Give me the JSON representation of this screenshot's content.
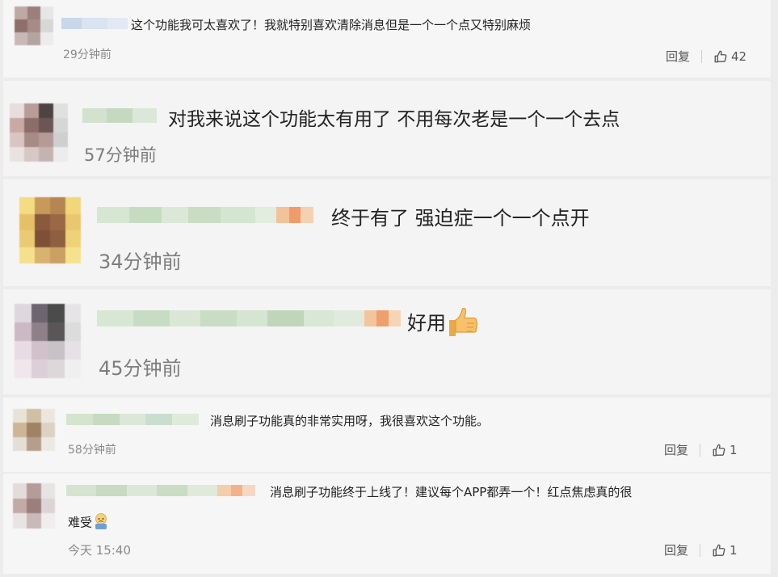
{
  "comments": [
    {
      "text": "这个功能我可太喜欢了！我就特别喜欢清除消息但是一个一个点又特别麻烦",
      "time": "29分钟前",
      "reply_label": "回复",
      "likes": "42",
      "like_icon": "thumbs-up-outline"
    },
    {
      "text": "对我来说这个功能太有用了 不用每次老是一个一个去点",
      "time": "57分钟前"
    },
    {
      "text": "终于有了 强迫症一个一个点开",
      "time": "34分钟前"
    },
    {
      "text": "好用",
      "emoji": "thumbs-up-emoji",
      "time": "45分钟前"
    },
    {
      "text": "消息刷子功能真的非常实用呀，我很喜欢这个功能。",
      "time": "58分钟前",
      "reply_label": "回复",
      "likes": "1",
      "like_icon": "thumbs-up-outline"
    },
    {
      "text_line1": "消息刷子功能终于上线了！建议每个APP都弄一个！红点焦虑真的很",
      "text_line2": "难受",
      "emoji": "worried-face-emoji",
      "time": "今天 15:40",
      "reply_label": "回复",
      "likes": "1",
      "like_icon": "thumbs-up-outline"
    }
  ],
  "colors": {
    "text": "#222222",
    "muted": "#8a8a8a",
    "card_bg": "#f6f6f6",
    "page_bg": "#ececec"
  }
}
